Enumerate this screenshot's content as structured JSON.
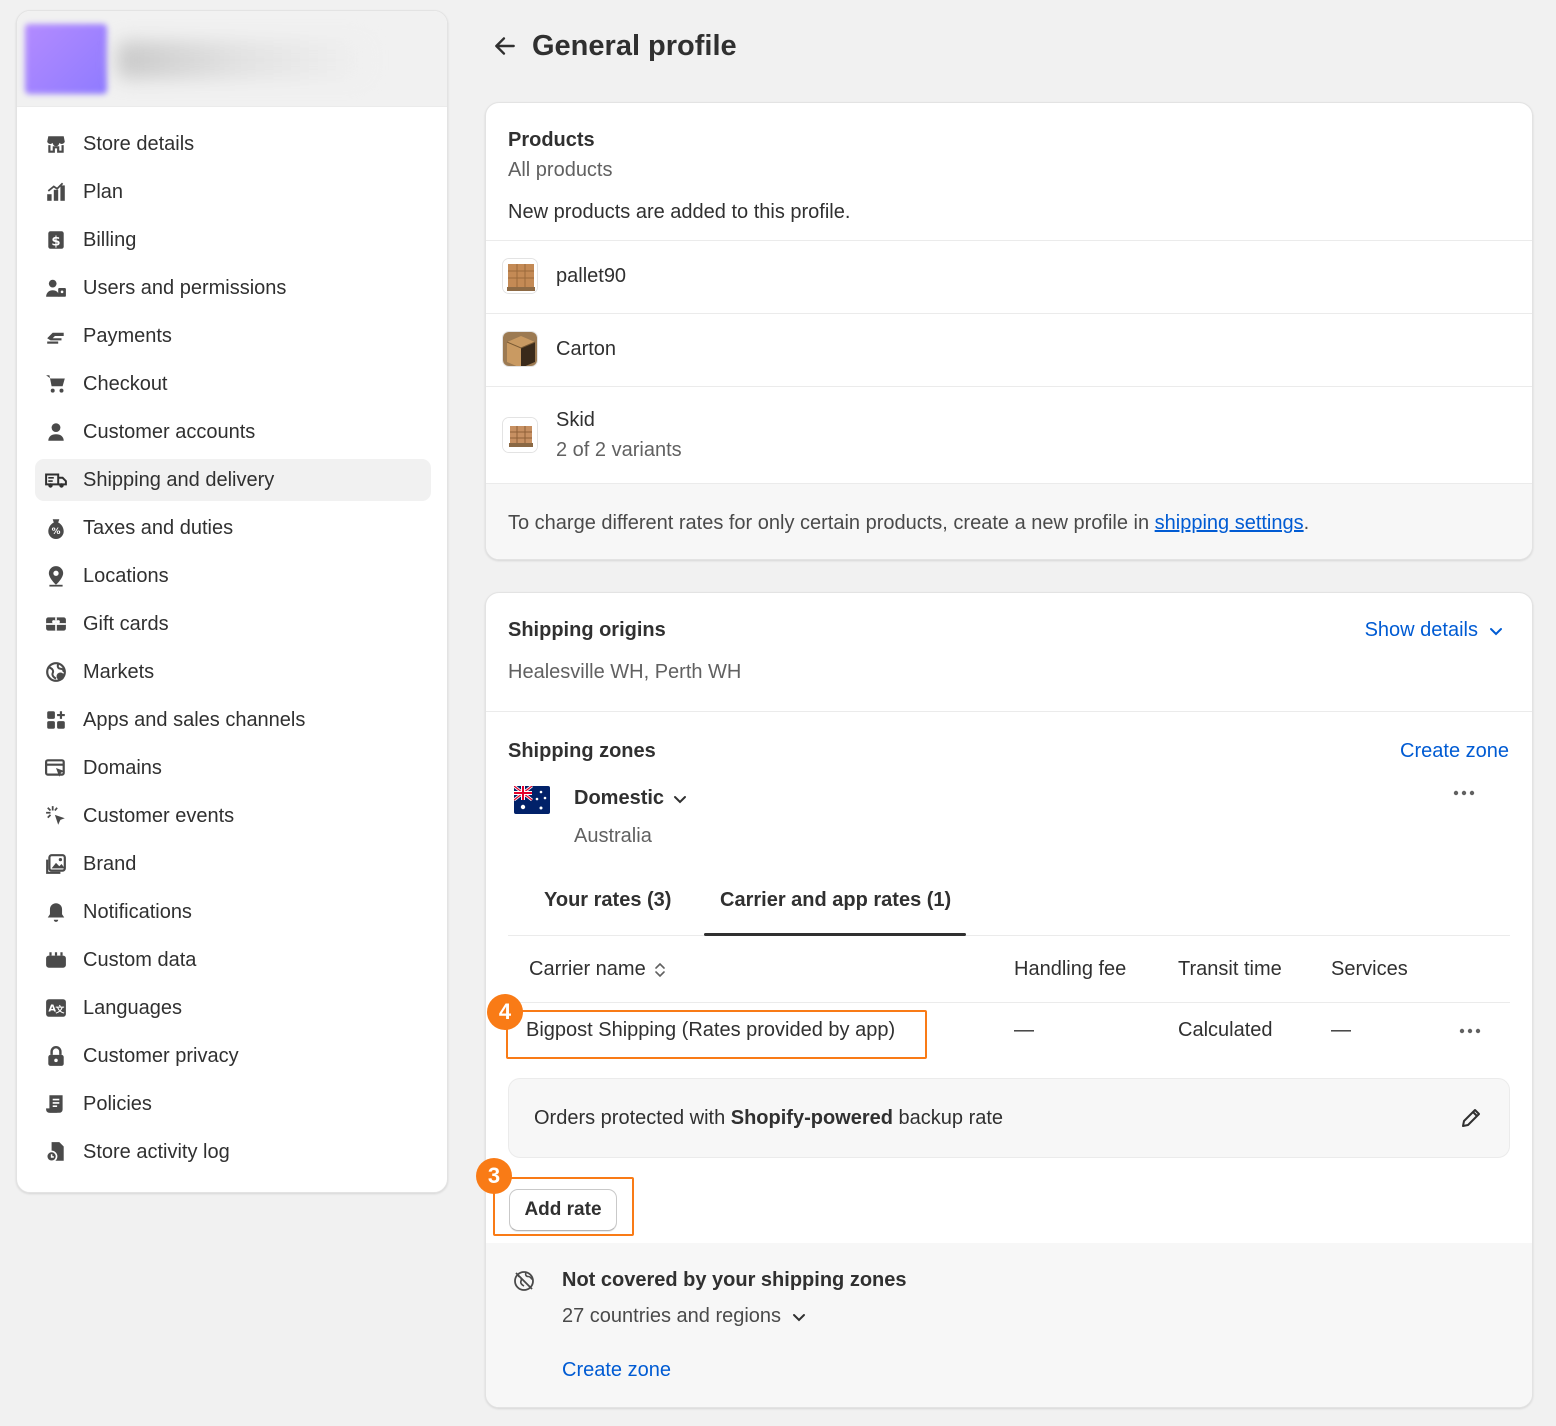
{
  "sidebar": {
    "items": [
      {
        "label": "Store details",
        "icon": "store-icon"
      },
      {
        "label": "Plan",
        "icon": "plan-icon"
      },
      {
        "label": "Billing",
        "icon": "billing-icon"
      },
      {
        "label": "Users and permissions",
        "icon": "users-icon"
      },
      {
        "label": "Payments",
        "icon": "payments-icon"
      },
      {
        "label": "Checkout",
        "icon": "cart-icon"
      },
      {
        "label": "Customer accounts",
        "icon": "person-icon"
      },
      {
        "label": "Shipping and delivery",
        "icon": "truck-icon",
        "active": true
      },
      {
        "label": "Taxes and duties",
        "icon": "tax-icon"
      },
      {
        "label": "Locations",
        "icon": "location-icon"
      },
      {
        "label": "Gift cards",
        "icon": "gift-card-icon"
      },
      {
        "label": "Markets",
        "icon": "globe-icon"
      },
      {
        "label": "Apps and sales channels",
        "icon": "apps-icon"
      },
      {
        "label": "Domains",
        "icon": "domains-icon"
      },
      {
        "label": "Customer events",
        "icon": "cursor-icon"
      },
      {
        "label": "Brand",
        "icon": "brand-icon"
      },
      {
        "label": "Notifications",
        "icon": "bell-icon"
      },
      {
        "label": "Custom data",
        "icon": "custom-data-icon"
      },
      {
        "label": "Languages",
        "icon": "language-icon"
      },
      {
        "label": "Customer privacy",
        "icon": "lock-icon"
      },
      {
        "label": "Policies",
        "icon": "policies-icon"
      },
      {
        "label": "Store activity log",
        "icon": "activity-log-icon"
      }
    ]
  },
  "page": {
    "title": "General profile"
  },
  "products": {
    "title": "Products",
    "subtitle": "All products",
    "description": "New products are added to this profile.",
    "items": [
      {
        "name": "pallet90",
        "variants": ""
      },
      {
        "name": "Carton",
        "variants": ""
      },
      {
        "name": "Skid",
        "variants": "2 of 2 variants"
      }
    ],
    "footer_text": "To charge different rates for only certain products, create a new profile in ",
    "footer_link": "shipping settings",
    "footer_end": "."
  },
  "origins": {
    "title": "Shipping origins",
    "show_details": "Show details",
    "locations": "Healesville WH, Perth WH"
  },
  "zones": {
    "title": "Shipping zones",
    "create_zone": "Create zone",
    "zone_name": "Domestic",
    "zone_country": "Australia",
    "tabs": [
      {
        "label": "Your rates (3)"
      },
      {
        "label": "Carrier and app rates (1)",
        "active": true
      }
    ],
    "columns": {
      "carrier": "Carrier name",
      "handling": "Handling fee",
      "transit": "Transit time",
      "services": "Services"
    },
    "row": {
      "carrier": "Bigpost Shipping (Rates provided by app)",
      "handling": "—",
      "transit": "Calculated",
      "services": "—"
    },
    "backup_prefix": "Orders protected with ",
    "backup_bold": "Shopify-powered",
    "backup_suffix": " backup rate",
    "add_rate": "Add rate"
  },
  "not_covered": {
    "title": "Not covered by your shipping zones",
    "count": "27 countries and regions",
    "create_zone": "Create zone"
  },
  "annotations": {
    "step_a": "4",
    "step_b": "3"
  },
  "colors": {
    "accent_link": "#005bd3",
    "annotation_orange": "#f97b16"
  }
}
